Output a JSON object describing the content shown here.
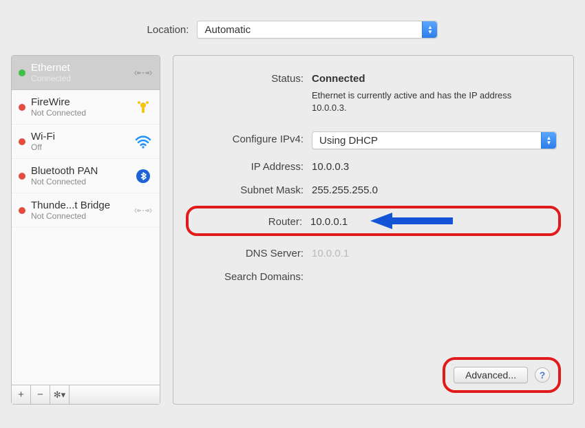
{
  "toolbar": {
    "location_label": "Location:",
    "location_value": "Automatic"
  },
  "sidebar": {
    "items": [
      {
        "name": "Ethernet",
        "status": "Connected",
        "dot": "green",
        "icon": "ethernet-icon",
        "selected": true
      },
      {
        "name": "FireWire",
        "status": "Not Connected",
        "dot": "red",
        "icon": "firewire-icon",
        "selected": false
      },
      {
        "name": "Wi-Fi",
        "status": "Off",
        "dot": "red",
        "icon": "wifi-icon",
        "selected": false
      },
      {
        "name": "Bluetooth PAN",
        "status": "Not Connected",
        "dot": "red",
        "icon": "bluetooth-icon",
        "selected": false
      },
      {
        "name": "Thunde...t Bridge",
        "status": "Not Connected",
        "dot": "red",
        "icon": "bridge-icon",
        "selected": false
      }
    ],
    "footer": {
      "add": "+",
      "remove": "−",
      "gear": "✻▾"
    }
  },
  "detail": {
    "status_label": "Status:",
    "status_value": "Connected",
    "status_description": "Ethernet is currently active and has the IP address 10.0.0.3.",
    "configure_label": "Configure IPv4:",
    "configure_value": "Using DHCP",
    "ip_label": "IP Address:",
    "ip_value": "10.0.0.3",
    "subnet_label": "Subnet Mask:",
    "subnet_value": "255.255.255.0",
    "router_label": "Router:",
    "router_value": "10.0.0.1",
    "dns_label": "DNS Server:",
    "dns_value": "10.0.0.1",
    "search_label": "Search Domains:",
    "search_value": "",
    "advanced_button": "Advanced...",
    "help_button": "?"
  },
  "annotations": {
    "router_highlight": true,
    "router_arrow_color": "#1455d8",
    "advanced_highlight": true,
    "highlight_color": "#e11b1b"
  }
}
